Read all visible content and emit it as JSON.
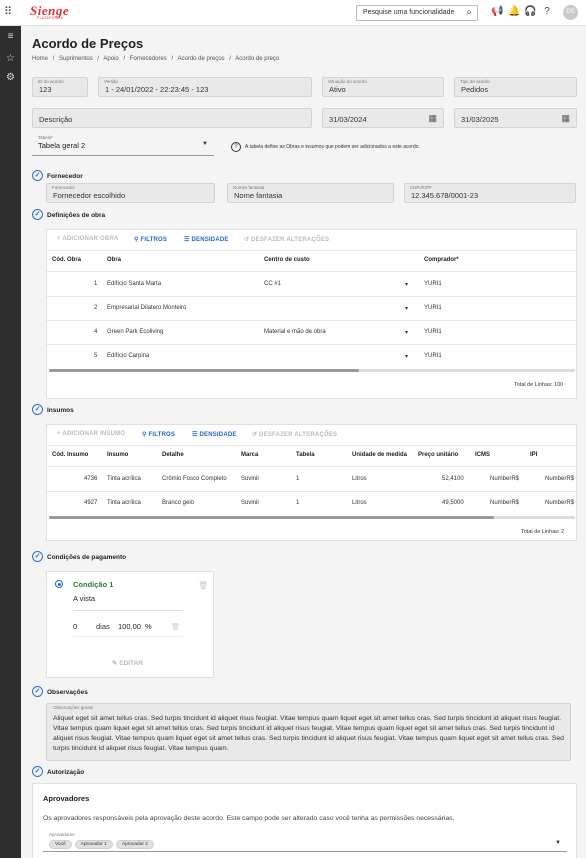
{
  "app": {
    "logo": "Sienge",
    "logo_sub": "PLATAFORMA",
    "search_placeholder": "Pesquise uma funcionalidade",
    "user_initials": "DS"
  },
  "page": {
    "title": "Acordo de Preços",
    "breadcrumb": [
      "Home",
      "/",
      "Suprimentos",
      "/",
      "Apoio",
      "/",
      "Fornecedores",
      "/",
      "Acordo de preços",
      "/",
      "Acordo de preço"
    ]
  },
  "form": {
    "id_label": "ID do acordo",
    "id_value": "123",
    "version_label": "Versão",
    "version_value": "1 - 24/01/2022 - 22:23:45 - 123",
    "status_label": "Situação do acordo",
    "status_value": "Ativo",
    "type_label": "Tipo de acordo",
    "type_value": "Pedidos",
    "description_value": "Descrição",
    "date_start": "31/03/2024",
    "date_end": "31/03/2025",
    "table_label": "Tabela*",
    "table_value": "Tabela geral 2",
    "table_info": "A tabela define as Obras e insumos que podem ser adicionados a este acordo."
  },
  "supplier": {
    "section": "Fornecedor",
    "supplier_label": "Fornecedor",
    "supplier_value": "Fornecedor escolhido",
    "fantasy_label": "Nomes fantasia",
    "fantasy_value": "Nome fantasia",
    "cnpj_label": "CNPJ/CPF",
    "cnpj_value": "12.345.678/0001-23"
  },
  "works": {
    "section": "Definições de obra",
    "toolbar": {
      "add": "+  ADICIONAR OBRA",
      "filters": "FILTROS",
      "density": "DENSIDADE",
      "undo": "DESFAZER ALTERAÇÕES"
    },
    "headers": [
      "Cód. Obra",
      "Obra",
      "Centro de custo",
      "Comprador*"
    ],
    "rows": [
      {
        "code": "1",
        "name": "Edifício Santa Marta",
        "cost": "CC #1",
        "buyer": "YURI1"
      },
      {
        "code": "2",
        "name": "Empresarial Dilatero Monteiro",
        "cost": "",
        "buyer": "YURI1"
      },
      {
        "code": "4",
        "name": "Green Park Ecoliving",
        "cost": "Material e mão de obra",
        "buyer": "YURI1"
      },
      {
        "code": "5",
        "name": "Edifício Carpina",
        "cost": "",
        "buyer": "YURI1"
      }
    ],
    "total_label": "Total de Linhas:",
    "total_value": "100"
  },
  "inputs": {
    "section": "Insumos",
    "toolbar": {
      "add": "+  ADICIONAR INSUMO",
      "filters": "FILTROS",
      "density": "DENSIDADE",
      "undo": "DESFAZER ALTERAÇÕES"
    },
    "headers": [
      "Cód. Insumo",
      "Insumo",
      "Detalhe",
      "Marca",
      "Tabela",
      "Unidade de medida",
      "Preço unitário",
      "ICMS",
      "IPI"
    ],
    "rows": [
      {
        "code": "4736",
        "name": "Tinta acrílica",
        "detail": "Crômio Fosco Completo",
        "brand": "Suvinil",
        "table": "1",
        "unit": "Litros",
        "price": "52,4100",
        "icms": "NumberR$",
        "ipi": "NumberR$"
      },
      {
        "code": "4927",
        "name": "Tinta acrílica",
        "detail": "Branco gelo",
        "brand": "Suvinil",
        "table": "1",
        "unit": "Litros",
        "price": "49,5000",
        "icms": "NumberR$",
        "ipi": "NumberR$"
      }
    ],
    "total_label": "Total de Linhas:",
    "total_value": "2"
  },
  "payment": {
    "section": "Condições de pagamento",
    "condition_title": "Condição 1",
    "condition_type": "A vista",
    "days": "0",
    "days_label": "dias",
    "percent": "100.00",
    "percent_label": "%",
    "edit": "EDITAR"
  },
  "observations": {
    "section": "Observações",
    "label": "Observações gerais",
    "text": "Aliquet eget sit amet tellus cras. Sed turpis tincidunt id aliquet risus feugiat. Vitae tempus quam liquet eget sit amet tellus cras. Sed turpis tincidunt id aliquet risus feugiat. Vitae tempus quam liquet eget sit amet tellus cras. Sed turpis tincidunt id aliquet risus feugiat. Vitae tempus quam liquet eget sit amet tellus cras. Sed turpis tincidunt id aliquet risus feugiat. Vitae tempus quam liquet eget sit amet tellus cras. Sed turpis tincidunt id aliquet risus feugiat. Vitae tempus quam liquet eget sit amet tellus cras. Sed turpis tincidunt id aliquet risus feugiat. Vitae tempus quam."
  },
  "authorization": {
    "section": "Autorização",
    "approvers_title": "Aprovadores",
    "description": "Os aprovadores responsáveis pela aprovação deste acordo. Este campo pode ser alterado caso você tenha as permissões necessárias.",
    "approvers_label": "Aprovadores",
    "chips": [
      "Você",
      "Aprovador 1",
      "Aprovador 2"
    ]
  },
  "colors": {
    "brand": "#e0322b",
    "accent": "#1f68c9",
    "sidebar": "#2e2e2e",
    "success": "#2e7d32"
  },
  "icons": {
    "apps": "grid-icon",
    "menu": "menu-icon",
    "favorites": "star-icon",
    "settings": "gear-icon",
    "search": "search-icon",
    "calendar": "calendar-icon",
    "delete": "trash-icon",
    "edit": "pencil-icon"
  }
}
